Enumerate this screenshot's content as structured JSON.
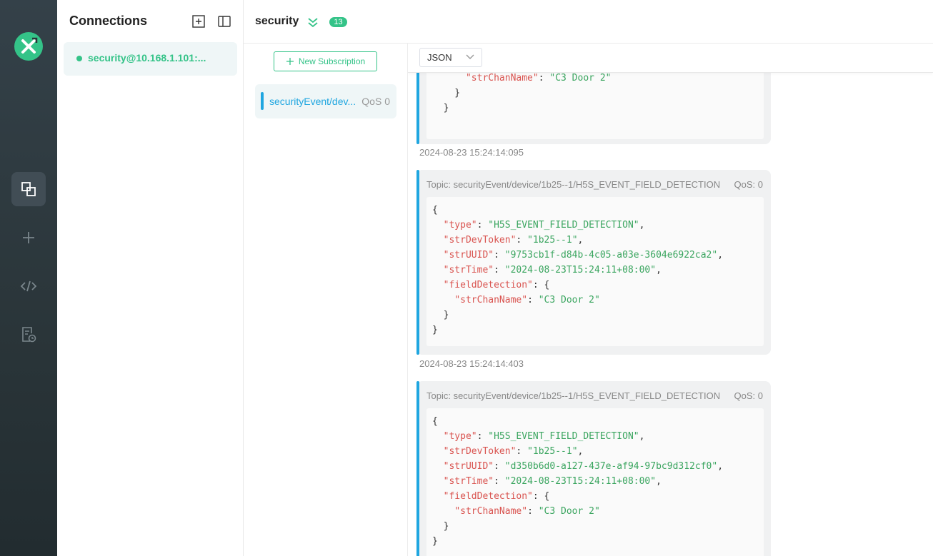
{
  "connections": {
    "title": "Connections",
    "active": "security@10.168.1.101:..."
  },
  "topbar": {
    "title": "security",
    "count": "13"
  },
  "subscriptions": {
    "new_label": "New Subscription",
    "items": [
      {
        "topic": "securityEvent/dev...",
        "qos": "QoS 0",
        "color": "#1fa6e0"
      }
    ]
  },
  "messages": {
    "format": "JSON",
    "partial": {
      "lines": [
        "  \"strChanName\": \"C3 Door 2\"",
        "  }",
        "}"
      ]
    },
    "items": [
      {
        "timestamp": "2024-08-23 15:24:14:095",
        "topic": "Topic: securityEvent/device/1b25--1/H5S_EVENT_FIELD_DETECTION",
        "qos": "QoS: 0",
        "payload": {
          "type": "H5S_EVENT_FIELD_DETECTION",
          "strDevToken": "1b25--1",
          "strUUID": "9753cb1f-d84b-4c05-a03e-3604e6922ca2",
          "strTime": "2024-08-23T15:24:11+08:00",
          "strChanName": "C3 Door 2"
        }
      },
      {
        "timestamp": "2024-08-23 15:24:14:403",
        "topic": "Topic: securityEvent/device/1b25--1/H5S_EVENT_FIELD_DETECTION",
        "qos": "QoS: 0",
        "payload": {
          "type": "H5S_EVENT_FIELD_DETECTION",
          "strDevToken": "1b25--1",
          "strUUID": "d350b6d0-a127-437e-af94-97bc9d312cf0",
          "strTime": "2024-08-23T15:24:11+08:00",
          "strChanName": "C3 Door 2"
        }
      }
    ]
  },
  "colors": {
    "accent": "#34c388",
    "topic": "#1fa6e0",
    "key": "#d9534f",
    "string": "#3aa55f"
  }
}
